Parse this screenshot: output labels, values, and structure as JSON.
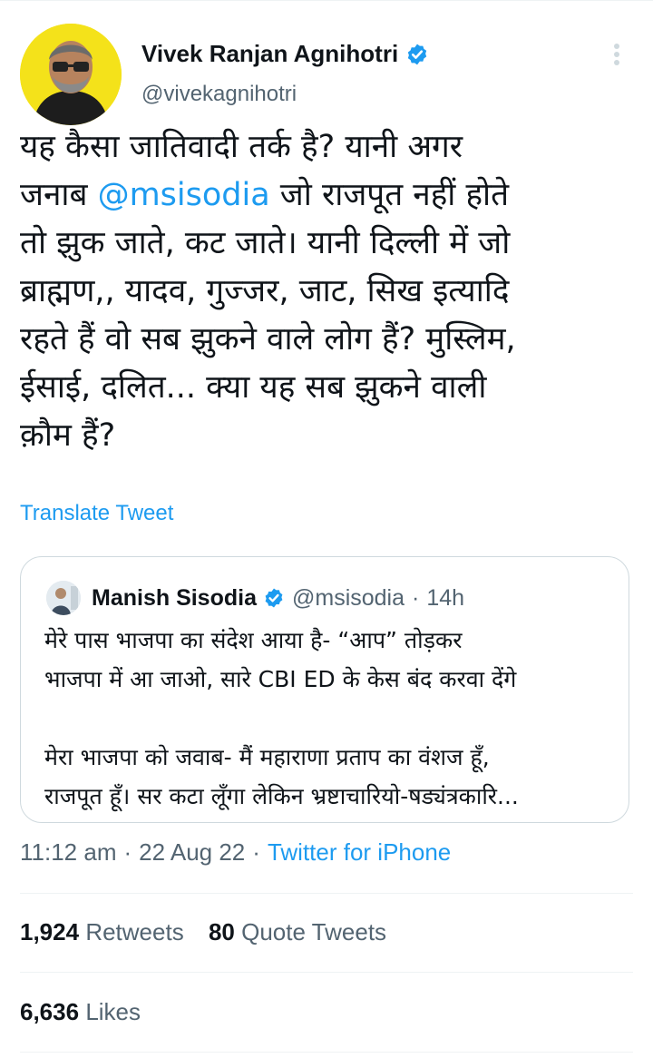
{
  "tweet": {
    "display_name": "Vivek Ranjan Agnihotri",
    "handle": "@vivekagnihotri",
    "text_before": "यह कैसा जातिवादी तर्क है? यानी अगर\nजनाब ",
    "mention": "@msisodia",
    "text_after": " जो राजपूत नहीं होते\nतो झुक जाते, कट जाते। यानी दिल्ली में जो\nब्राह्मण,, यादव, गुज्जर, जाट, सिख इत्यादि\nरहते हैं वो सब झुकने वाले लोग हैं? मुस्लिम,\nईसाई, दलित... क्या यह सब झुकने वाली\nक़ौम हैं?",
    "translate_label": "Translate Tweet",
    "time": "11:12 am",
    "date": "22 Aug 22",
    "source": "Twitter for iPhone",
    "retweets_count": "1,924",
    "retweets_label": "Retweets",
    "quotes_count": "80",
    "quotes_label": "Quote Tweets",
    "likes_count": "6,636",
    "likes_label": "Likes"
  },
  "quoted_tweet": {
    "display_name": "Manish Sisodia",
    "handle": "@msisodia",
    "age": "14h",
    "text": "मेरे पास भाजपा का संदेश आया है- “आप” तोड़कर\nभाजपा में आ जाओ, सारे CBI ED के केस बंद करवा देंगे\n\nमेरा भाजपा को जवाब- मैं महाराणा प्रताप का वंशज हूँ,\nराजपूत हूँ। सर कटा लूँगा लेकिन भ्रष्टाचारियो-षड्यंत्रकारि..."
  },
  "separator": "·",
  "icons": {
    "verified": "verified-badge-icon",
    "more": "more-vertical-icon"
  },
  "colors": {
    "accent": "#1d9bf0",
    "text": "#0f1419",
    "muted": "#536471",
    "avatar_bg": "#f4e21a"
  }
}
